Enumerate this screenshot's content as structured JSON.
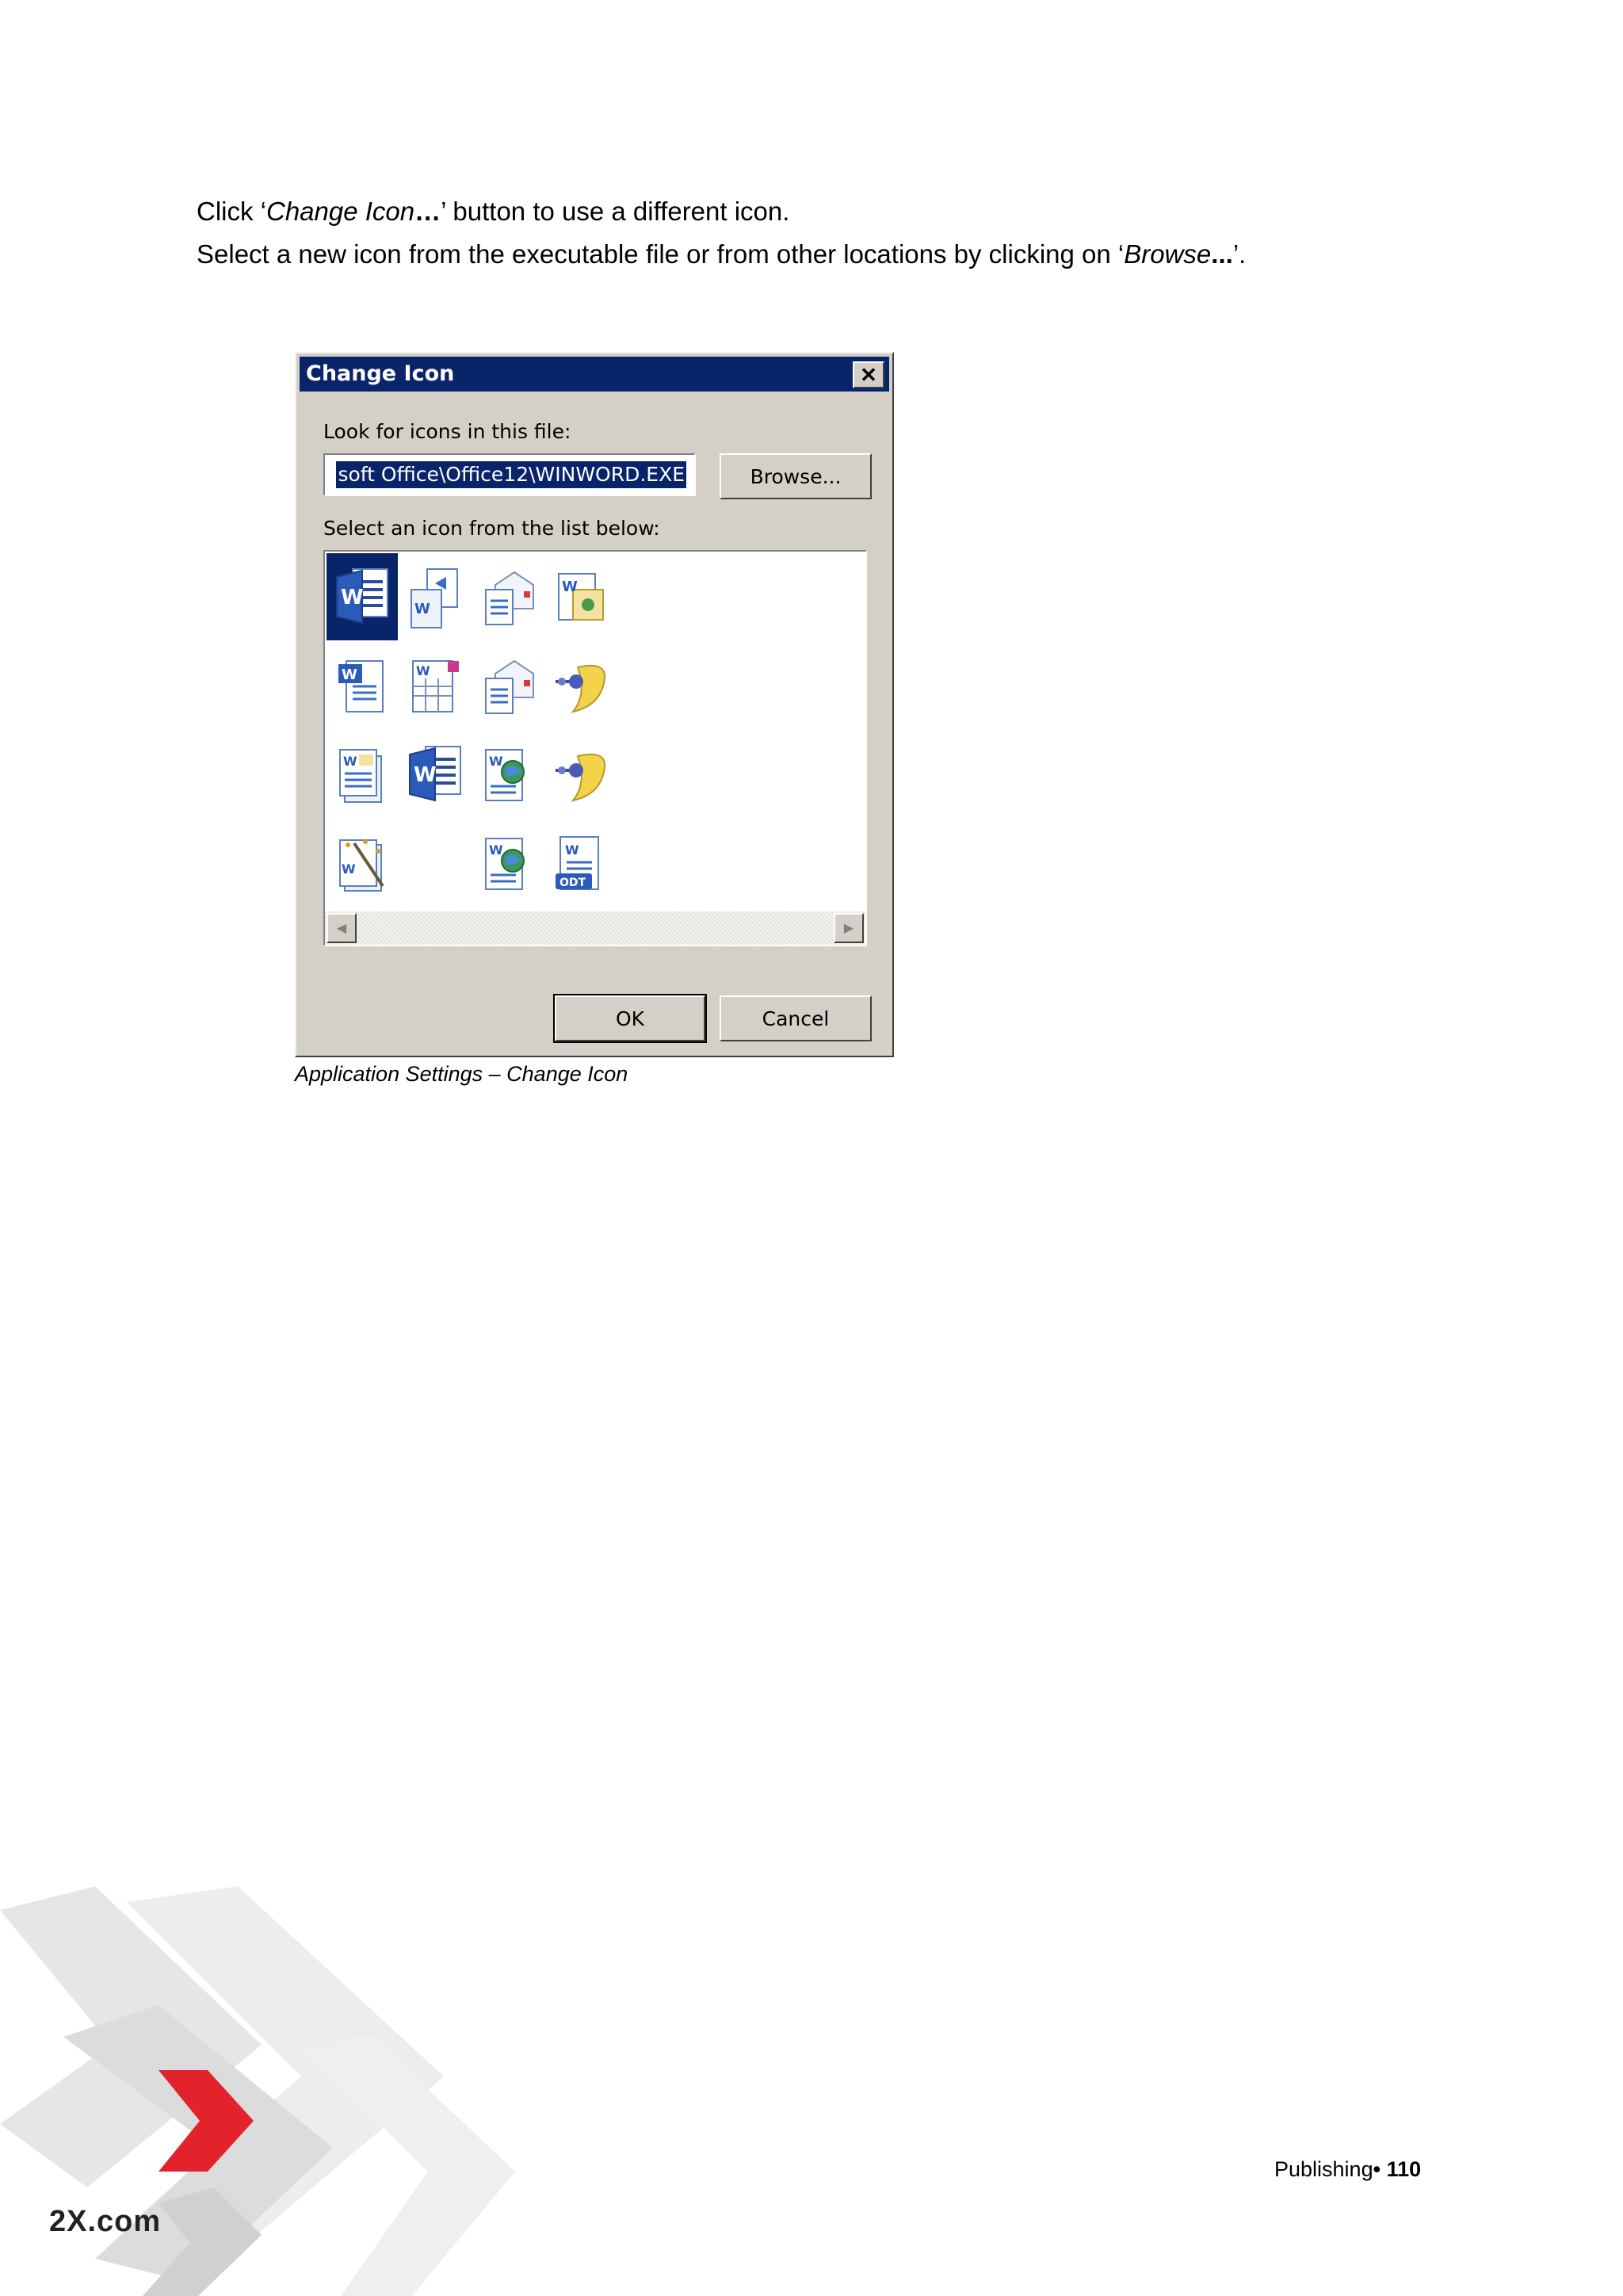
{
  "body": {
    "line1_a": "Click ‘",
    "line1_em": "Change Icon",
    "line1_b": "…",
    "line1_c": "’ button to use a different icon.",
    "line2_a": "Select a new icon from the executable file or from other locations by clicking on ‘",
    "line2_em": "Browse",
    "line2_b": "...",
    "line2_c": "’."
  },
  "dialog": {
    "title": "Change Icon",
    "close_glyph": "✕",
    "look_label": "Look for icons in this file:",
    "file_value": "soft Office\\Office12\\WINWORD.EXE",
    "browse_label": "Browse...",
    "select_label": "Select an icon from the list below:",
    "ok_label": "OK",
    "cancel_label": "Cancel",
    "scroll_left": "◀",
    "scroll_right": "▶",
    "odt_badge": "ODT",
    "w_letter": "W"
  },
  "caption": "Application Settings – Change Icon",
  "footer": {
    "section": "Publishing",
    "bullet": "• ",
    "page": "110"
  },
  "logo": "2X.com",
  "colors": {
    "titlebar": "#0a246a",
    "dialog_face": "#d4d0c8",
    "logo_red": "#e3232c"
  }
}
